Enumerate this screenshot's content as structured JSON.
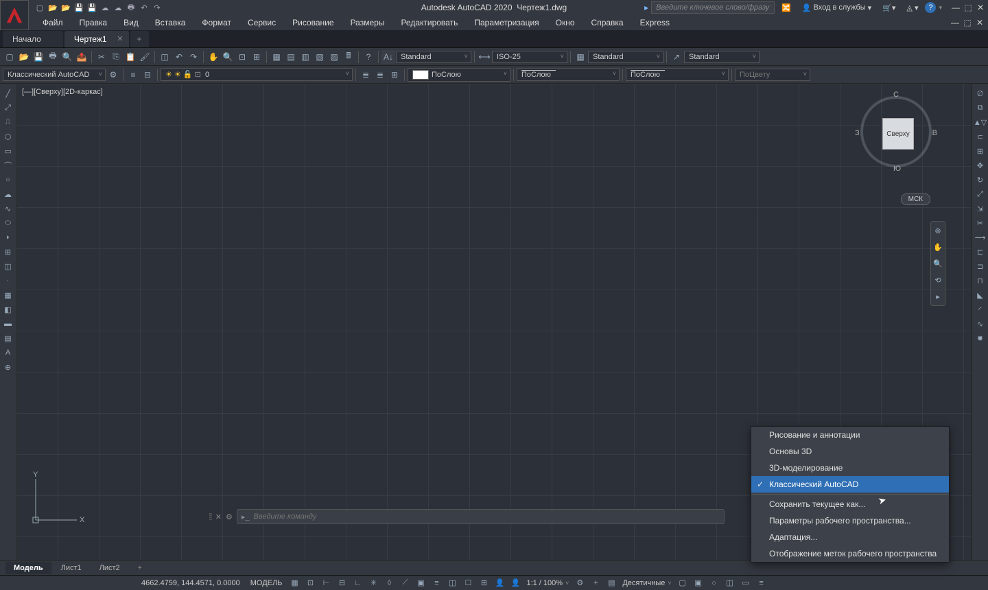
{
  "title": {
    "app": "Autodesk AutoCAD 2020",
    "file": "Чертеж1.dwg"
  },
  "search_placeholder": "Введите ключевое слово/фразу",
  "signin": "Вход в службы",
  "menus": [
    "Файл",
    "Правка",
    "Вид",
    "Вставка",
    "Формат",
    "Сервис",
    "Рисование",
    "Размеры",
    "Редактировать",
    "Параметризация",
    "Окно",
    "Справка",
    "Express"
  ],
  "tabs": {
    "inactive": "Начало",
    "active": "Чертеж1"
  },
  "toolbar2": {
    "workspace": "Классический AutoCAD",
    "layer": "0",
    "color": "ПоСлою",
    "linetype": "ПоСлою",
    "lineweight": "ПоСлою",
    "plotstyle": "ПоЦвету"
  },
  "props": {
    "textstyle": "Standard",
    "dimstyle": "ISO-25",
    "tablestyle": "Standard",
    "mleader": "Standard"
  },
  "viewport_label": "[—][Сверху][2D-каркас]",
  "viewcube": {
    "top": "С",
    "right": "В",
    "bottom": "Ю",
    "left": "З",
    "face": "Сверху",
    "wcs": "МСК"
  },
  "cmd_placeholder": "Введите команду",
  "layout_tabs": [
    "Модель",
    "Лист1",
    "Лист2"
  ],
  "status": {
    "coords": "4662.4759, 144.4571, 0.0000",
    "space": "МОДЕЛЬ",
    "scale": "1:1 / 100%",
    "units": "Десятичные"
  },
  "context_menu": {
    "items1": [
      "Рисование и аннотации",
      "Основы 3D",
      "3D-моделирование"
    ],
    "checked": "Классический AutoCAD",
    "items2": [
      "Сохранить текущее как...",
      "Параметры рабочего пространства...",
      "Адаптация...",
      "Отображение меток рабочего пространства"
    ]
  }
}
